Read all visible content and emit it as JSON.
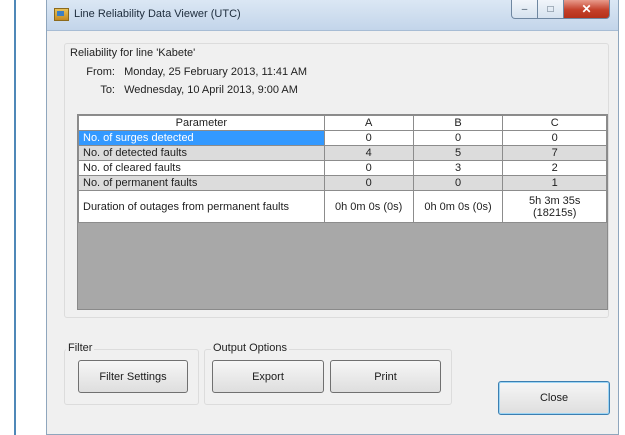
{
  "window": {
    "title": "Line Reliability Data Viewer (UTC)",
    "controls": {
      "minimize": "–",
      "maximize": "□",
      "close": "✕"
    }
  },
  "reliability": {
    "heading": "Reliability for line 'Kabete'",
    "from_label": "From:",
    "from_value": "Monday, 25 February 2013, 11:41 AM",
    "to_label": "To:",
    "to_value": "Wednesday, 10 April 2013, 9:00 AM"
  },
  "table": {
    "headers": [
      "Parameter",
      "A",
      "B",
      "C"
    ],
    "rows": [
      {
        "label": "No. of surges detected",
        "a": "0",
        "b": "0",
        "c": "0"
      },
      {
        "label": "No. of detected faults",
        "a": "4",
        "b": "5",
        "c": "7"
      },
      {
        "label": "No. of cleared faults",
        "a": "0",
        "b": "3",
        "c": "2"
      },
      {
        "label": "No. of permanent faults",
        "a": "0",
        "b": "0",
        "c": "1"
      },
      {
        "label": "Duration of outages from permanent faults",
        "a": "0h 0m 0s (0s)",
        "b": "0h 0m 0s (0s)",
        "c": "5h 3m 35s (18215s)"
      }
    ]
  },
  "filter": {
    "group_label": "Filter",
    "button_label": "Filter Settings"
  },
  "output": {
    "group_label": "Output Options",
    "export_label": "Export",
    "print_label": "Print"
  },
  "close_label": "Close",
  "icons": {
    "app": "chart-window-icon",
    "minimize": "minimize-icon",
    "maximize": "maximize-icon",
    "close": "close-icon"
  },
  "colors": {
    "selection": "#3399ff",
    "alt_row": "#dcdcdc",
    "empty_grid": "#a8a8a8",
    "close_button": "#c4402a"
  }
}
